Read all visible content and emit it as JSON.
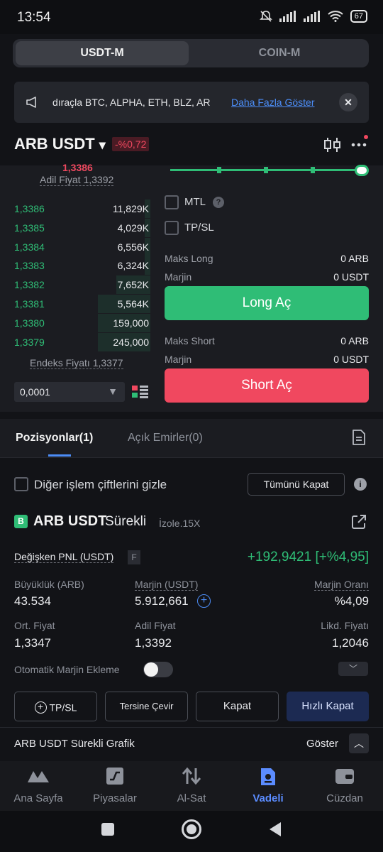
{
  "status_bar": {
    "time": "13:54",
    "battery": "67"
  },
  "segment": {
    "active": "USDT-M",
    "inactive": "COIN-M"
  },
  "banner": {
    "text": "dıraçla BTC, ALPHA, ETH, BLZ, AR",
    "link": "Daha Fazla Göster",
    "close": "✕"
  },
  "pair": {
    "name": "ARB USDT",
    "arrow": "▾",
    "change": "-%0,72"
  },
  "orderbook": {
    "fair_price_label": "Adil Fiyat 1,3392",
    "rows": [
      {
        "price": "1,3386",
        "qty": "11,829K"
      },
      {
        "price": "1,3385",
        "qty": "4,029K"
      },
      {
        "price": "1,3384",
        "qty": "6,556K"
      },
      {
        "price": "1,3383",
        "qty": "6,324K"
      },
      {
        "price": "1,3382",
        "qty": "7,652K"
      },
      {
        "price": "1,3381",
        "qty": "5,564K"
      },
      {
        "price": "1,3380",
        "qty": "159,000"
      },
      {
        "price": "1,3379",
        "qty": "245,000"
      }
    ],
    "index_price_label": "Endeks Fiyatı 1,3377",
    "tick_size": "0,0001"
  },
  "order_form": {
    "mtl_label": "MTL",
    "tpsl_label": "TP/SL",
    "max_long_label": "Maks Long",
    "max_long_value": "0 ARB",
    "margin_label": "Marjin",
    "margin_long_value": "0 USDT",
    "long_button": "Long Aç",
    "max_short_label": "Maks Short",
    "max_short_value": "0 ARB",
    "margin_short_value": "0 USDT",
    "short_button": "Short Aç"
  },
  "tabs": {
    "positions": "Pozisyonlar(1)",
    "open_orders": "Açık Emirler(0)"
  },
  "positions": {
    "hide_other_pairs": "Diğer işlem çiftlerini gizle",
    "close_all": "Tümünü Kapat",
    "contract_badge": "B",
    "contract_name": "ARB USDT",
    "contract_type": "Sürekli",
    "margin_mode": "İzole.15X",
    "pnl_label": "Değişken PNL (USDT)",
    "pnl_flag": "F",
    "pnl_value": "+192,9421 [+%4,95]",
    "size_label": "Büyüklük (ARB)",
    "size_value": "43.534",
    "margin_label": "Marjin (USDT)",
    "margin_value": "5.912,661",
    "margin_ratio_label": "Marjin Oranı",
    "margin_ratio_value": "%4,09",
    "avg_price_label": "Ort. Fiyat",
    "avg_price_value": "1,3347",
    "fair_price_label": "Adil Fiyat",
    "fair_price_value": "1,3392",
    "liq_price_label": "Likd. Fiyatı",
    "liq_price_value": "1,2046",
    "auto_margin_label": "Otomatik Marjin Ekleme",
    "btn_tpsl": "TP/SL",
    "btn_reverse": "Tersine Çevir",
    "btn_close": "Kapat",
    "btn_quick_close": "Hızlı Kapat",
    "chart_label": "ARB USDT Sürekli Grafik",
    "show_label": "Göster"
  },
  "bottom_nav": [
    {
      "label": "Ana Sayfa",
      "icon": "home-icon",
      "active": false
    },
    {
      "label": "Piyasalar",
      "icon": "markets-icon",
      "active": false
    },
    {
      "label": "Al-Sat",
      "icon": "trade-icon",
      "active": false
    },
    {
      "label": "Vadeli",
      "icon": "futures-icon",
      "active": true
    },
    {
      "label": "Cüzdan",
      "icon": "wallet-icon",
      "active": false
    }
  ],
  "colors": {
    "green": "#2fbd76",
    "red": "#f0485f",
    "accent_blue": "#4c8df7",
    "active_nav": "#5b8cff"
  }
}
